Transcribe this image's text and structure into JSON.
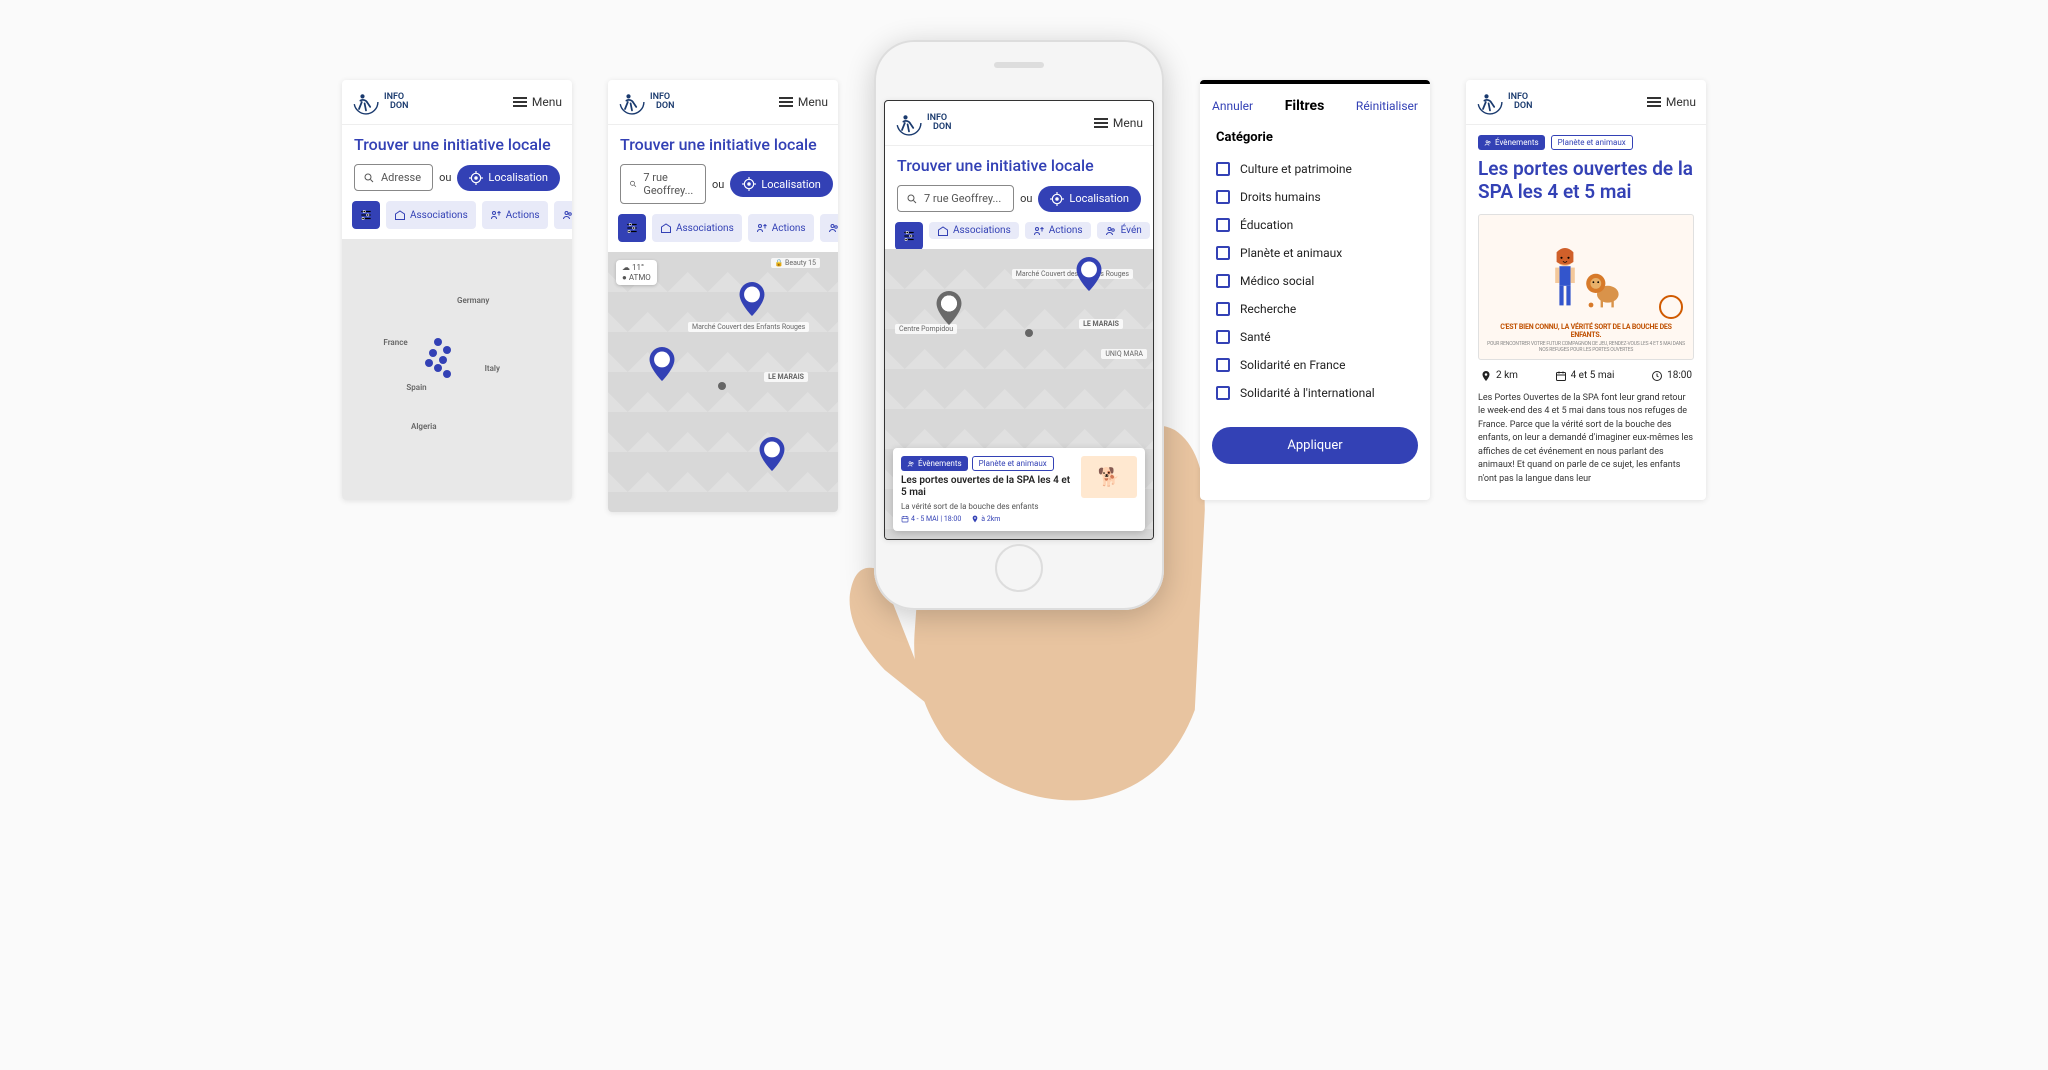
{
  "brand": {
    "name_top": "INFO",
    "name_bot": "DON"
  },
  "menu_label": "Menu",
  "title": "Trouver une initiative locale",
  "or_label": "ou",
  "address_placeholder": "Adresse",
  "address_value": "7 rue Geoffrey...",
  "loc_button": "Localisation",
  "chips": {
    "associations": "Associations",
    "actions": "Actions",
    "events_short": "Évén"
  },
  "weather": {
    "temp": "11°",
    "atmo": "ATMO"
  },
  "map_pois": {
    "beauty": "Beauty 15",
    "marche": "Marché Couvert des Enfants Rouges",
    "marais": "LE MARAIS",
    "pompidou": "Centre Pompidou",
    "uniq": "UNIQ MARA"
  },
  "event": {
    "tag_primary": "Évènements",
    "tag_outline": "Planète et animaux",
    "title": "Les portes ouvertes de la SPA les 4 et 5 mai",
    "subtitle": "La vérité sort de la bouche des enfants",
    "date": "4 - 5 MAI | 18:00",
    "distance": "à 2km"
  },
  "filters": {
    "cancel": "Annuler",
    "title": "Filtres",
    "reset": "Réinitialiser",
    "category_h": "Catégorie",
    "categories": [
      "Culture et patrimoine",
      "Droits humains",
      "Éducation",
      "Planète et animaux",
      "Médico social",
      "Recherche",
      "Santé",
      "Solidarité en France",
      "Solidarité à l'international"
    ],
    "apply": "Appliquer"
  },
  "detail": {
    "tag_primary": "Évènements",
    "tag_outline": "Planète et animaux",
    "title": "Les portes ouvertes de la SPA les 4 et 5 mai",
    "poster_caption": "C'EST BIEN CONNU, LA VÉRITÉ SORT DE LA BOUCHE DES ENFANTS.",
    "poster_sub": "POUR RENCONTRER VOTRE FUTUR COMPAGNON DE JEU, RENDEZ-VOUS LES 4 ET 5 MAI DANS NOS REFUGES POUR LES PORTES OUVERTES",
    "distance": "2 km",
    "date": "4 et 5 mai",
    "time": "18:00",
    "description": "Les Portes Ouvertes de la SPA font leur grand retour le week-end des 4 et 5 mai dans tous nos refuges de France. Parce que la vérité sort de la bouche des enfants, on leur a demandé d'imaginer eux-mêmes les affiches de cet événement en nous parlant des animaux! Et quand on parle de ce sujet, les enfants n'ont pas la langue dans leur"
  }
}
